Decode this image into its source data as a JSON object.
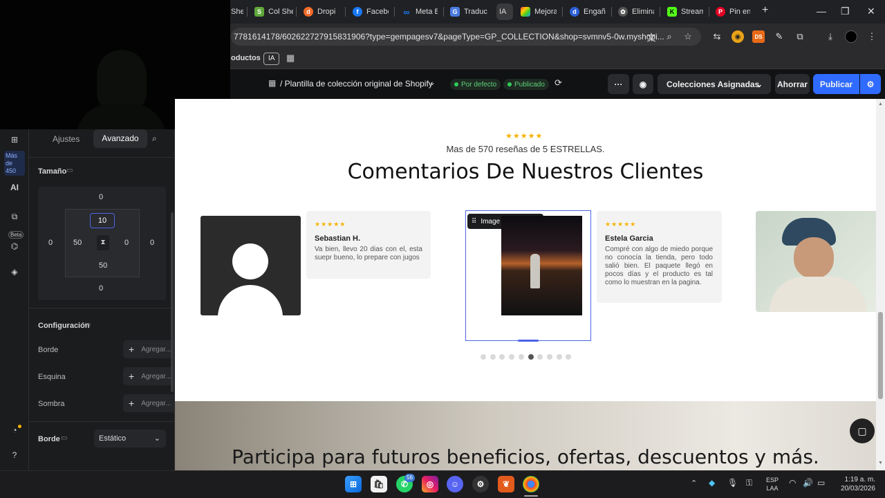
{
  "browser": {
    "tabs": [
      {
        "label": "She",
        "icon": "tab-favicon"
      },
      {
        "label": "Col She",
        "icon": "shopify-icon"
      },
      {
        "label": "Dropi",
        "icon": "dropi-icon"
      },
      {
        "label": "Facebo",
        "icon": "facebook-icon"
      },
      {
        "label": "Meta B",
        "icon": "meta-icon"
      },
      {
        "label": "Traduct",
        "icon": "translate-icon"
      },
      {
        "label": "IA",
        "icon": "ia-icon",
        "active": true
      },
      {
        "label": "Mejora",
        "icon": "colorful-icon"
      },
      {
        "label": "Engañ",
        "icon": "d-icon"
      },
      {
        "label": "Elimina",
        "icon": "openai-icon"
      },
      {
        "label": "Stream",
        "icon": "k-icon"
      },
      {
        "label": "Pin en",
        "icon": "pinterest-icon"
      }
    ],
    "new_tab": "+",
    "url": "7781614178/602622727915831906?type=gempagesv7&pageType=GP_COLLECTION&shop=svmnv5-0w.myshopi...",
    "bookmarks": {
      "productos": "oductos",
      "ia": "IA"
    }
  },
  "editor": {
    "breadcrumb": "/ Plantilla de colección original de Shopify",
    "badge_default": "Por defecto",
    "badge_published": "Publicado",
    "more": "···",
    "assigned": "Colecciones Asignadas",
    "save": "Ahorrar",
    "publish": "Publicar"
  },
  "rail": {
    "more_badge": "Más de 450",
    "ai": "AI",
    "beta": "Beta"
  },
  "panel": {
    "tab_settings": "Ajustes",
    "tab_advanced": "Avanzado",
    "size_title": "Tamaño",
    "margin_top": "0",
    "margin_left": "0",
    "margin_right": "0",
    "margin_bottom": "0",
    "padding_top": "10",
    "padding_left": "50",
    "padding_right": "0",
    "padding_bottom": "50",
    "config_title": "Configuración",
    "border_label": "Borde",
    "corner_label": "Esquina",
    "shadow_label": "Sombra",
    "add_placeholder": "Agregar...",
    "border2_label": "Borde",
    "border2_value": "Estático"
  },
  "canvas": {
    "rating_stars": "★★★★★",
    "subtitle": "Mas de 570 reseñas de 5 ESTRELLAS.",
    "heading": "Comentarios De Nuestros Clientes",
    "review1": {
      "stars": "★★★★★",
      "name": "Sebastian H.",
      "text": "Va bien, llevo 20 dias con el, esta suepr bueno, lo prepare con jugos"
    },
    "review2": {
      "stars": "★★★★★",
      "name": "Estela Garcia",
      "text": "Compré con algo de miedo porque no conocía la tienda, pero todo salió bien. El paquete llegó en pocos días y el producto es tal como lo muestran en la pagina."
    },
    "image_toolbar_label": "Image",
    "banner_text": "Participa para futuros beneficios, ofertas, descuentos y más.",
    "dots_count": 10,
    "active_dot": 5
  },
  "taskbar": {
    "whatsapp_badge": "56",
    "lang_line1": "ESP",
    "lang_line2": "LAA",
    "time": "1:19 a. m.",
    "date": "20/03/2026"
  },
  "colors": {
    "accent": "#3b6cff",
    "publish": "#2f6bff",
    "stars": "#f5b301",
    "selection": "#4a64e8"
  }
}
